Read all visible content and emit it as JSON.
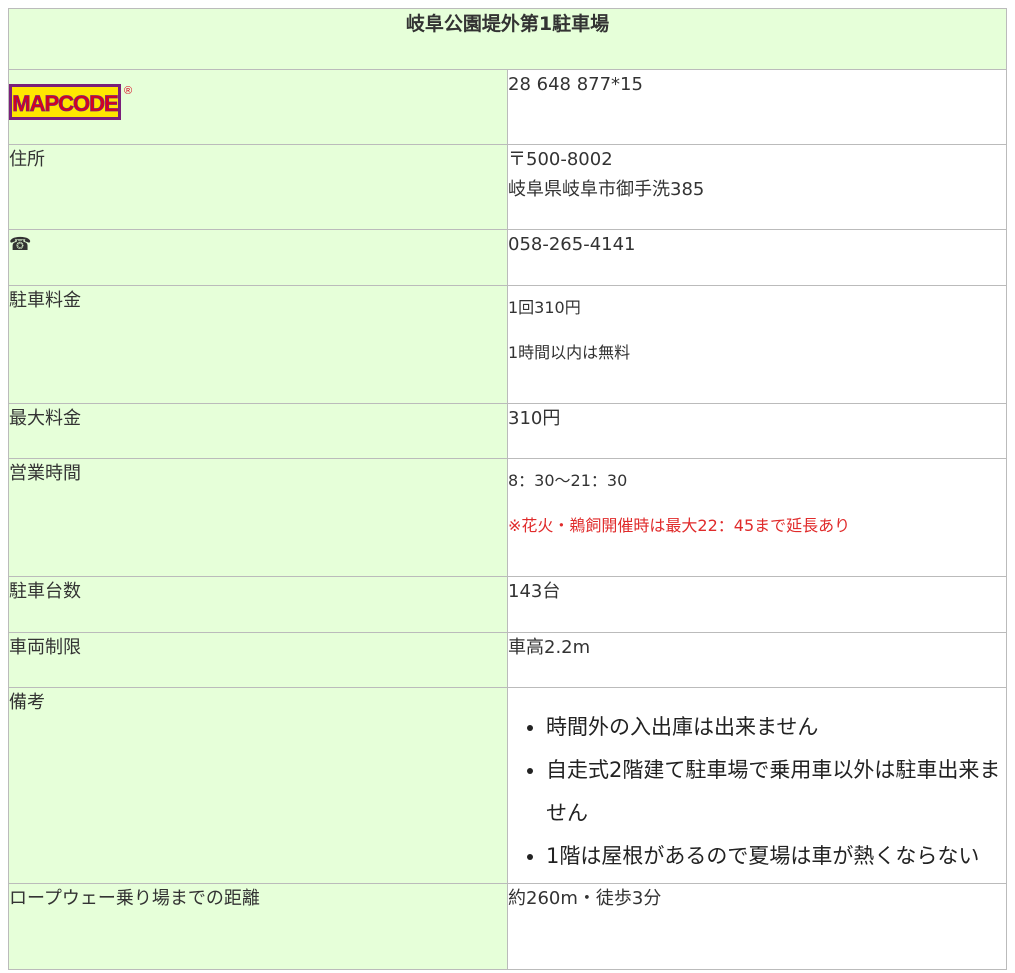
{
  "title": "岐阜公園堤外第1駐車場",
  "colors": {
    "header_bg": "#e6ffd9",
    "note_red": "#e02b2b",
    "logo_yellow": "#ffe600",
    "logo_red": "#d8001c",
    "logo_purple": "#7a1f7a"
  },
  "mapcode": {
    "logo_text": "MAPCODE",
    "logo_mark": "®",
    "value": "28 648 877*15"
  },
  "address": {
    "label": "住所",
    "postal": "〒500-8002",
    "line": "岐阜県岐阜市御手洗385"
  },
  "phone": {
    "icon": "phone-icon",
    "glyph": "☎",
    "value": "058-265-4141"
  },
  "fee": {
    "label": "駐車料金",
    "line1": "1回310円",
    "line2": "1時間以内は無料"
  },
  "max_fee": {
    "label": "最大料金",
    "value": "310円"
  },
  "hours": {
    "label": "営業時間",
    "value": "8：30～21：30",
    "note": "※花火・鵜飼開催時は最大22：45まで延長あり"
  },
  "capacity": {
    "label": "駐車台数",
    "value": "143台"
  },
  "restriction": {
    "label": "車両制限",
    "value": "車高2.2m"
  },
  "remarks": {
    "label": "備考",
    "items": [
      "時間外の入出庫は出来ません",
      "自走式2階建て駐車場で乗用車以外は駐車出来ません",
      "1階は屋根があるので夏場は車が熱くならない"
    ]
  },
  "distance": {
    "label": "ロープウェー乗り場までの距離",
    "value": "約260m・徒歩3分"
  }
}
